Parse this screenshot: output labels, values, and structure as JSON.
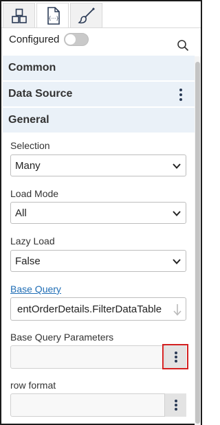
{
  "tabs": [
    {
      "name": "components-tab",
      "icon": "grid-icon",
      "active": false
    },
    {
      "name": "code-tab",
      "icon": "code-icon",
      "active": true
    },
    {
      "name": "style-tab",
      "icon": "brush-icon",
      "active": false
    }
  ],
  "configured": {
    "label": "Configured",
    "on": false
  },
  "sections": {
    "common": "Common",
    "data_source": "Data Source",
    "general": "General"
  },
  "fields": {
    "selection": {
      "label": "Selection",
      "value": "Many"
    },
    "load_mode": {
      "label": "Load Mode",
      "value": "All"
    },
    "lazy_load": {
      "label": "Lazy Load",
      "value": "False"
    },
    "base_query": {
      "label": "Base Query",
      "value": "entOrderDetails.FilterDataTable"
    },
    "base_query_parameters": {
      "label": "Base Query Parameters",
      "value": ""
    },
    "row_format": {
      "label": "row format",
      "value": ""
    }
  },
  "colors": {
    "accent_link": "#1f6db5",
    "section_bg": "#eaf1f8",
    "highlight": "#d32020"
  }
}
